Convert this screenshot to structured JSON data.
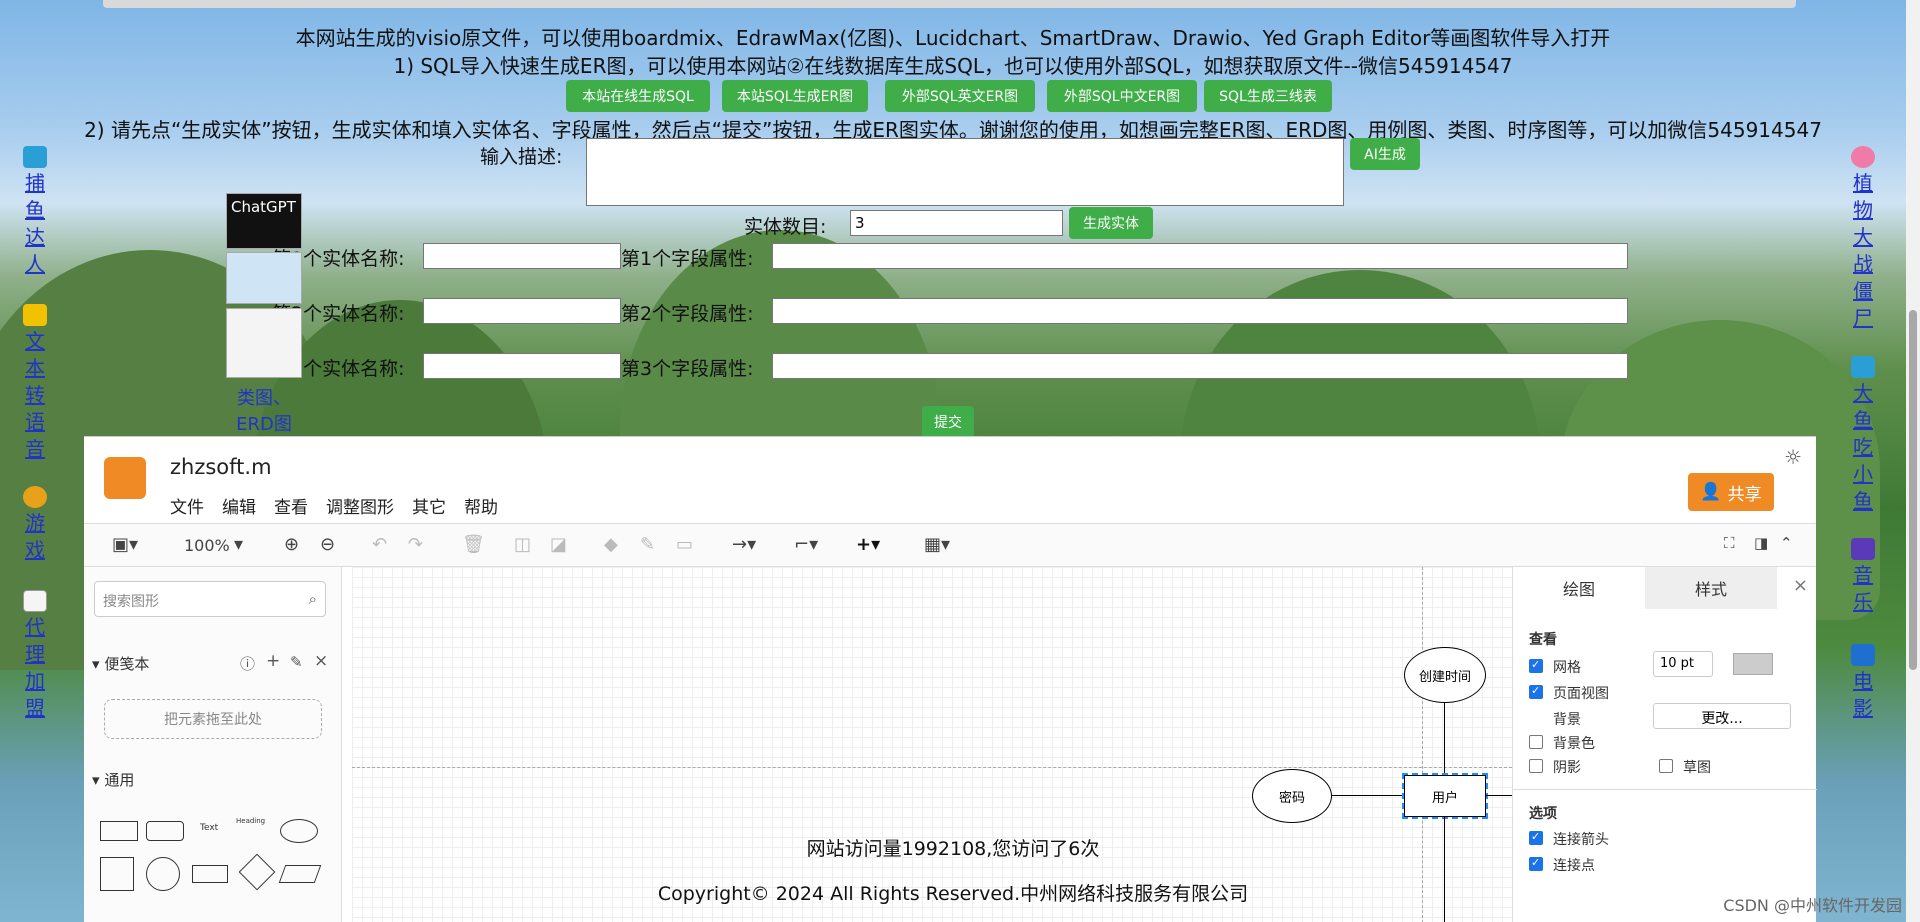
{
  "banner": {
    "line1": "本网站生成的visio原文件，可以使用boardmix、EdrawMax(亿图)、Lucidchart、SmartDraw、Drawio、Yed Graph Editor等画图软件导入打开",
    "line2": "1) SQL导入快速生成ER图，可以使用本网站②在线数据库生成SQL，也可以使用外部SQL，如想获取原文件--微信545914547",
    "line3": "2) 请先点“生成实体”按钮，生成实体和填入实体名、字段属性，然后点“提交”按钮，生成ER图实体。谢谢您的使用，如想画完整ER图、ERD图、用例图、类图、时序图等，可以加微信545914547"
  },
  "buttons": {
    "b1": "本站在线生成SQL",
    "b2": "本站SQL生成ER图",
    "b3": "外部SQL英文ER图",
    "b4": "外部SQL中文ER图",
    "b5": "SQL生成三线表",
    "ai": "AI生成",
    "gen": "生成实体",
    "submit": "提交"
  },
  "form": {
    "desc_label": "输入描述:",
    "count_label": "实体数目:",
    "count_value": "3",
    "rows": [
      {
        "name_label": "第1个实体名称:",
        "attr_label": "第1个字段属性:"
      },
      {
        "name_label": "第2个实体名称:",
        "attr_label": "第2个字段属性:"
      },
      {
        "name_label": "第3个实体名称:",
        "attr_label": "第3个字段属性:"
      }
    ]
  },
  "left_links": [
    "捕鱼达人",
    "文本转语音",
    "游戏",
    "代理加盟"
  ],
  "right_links": [
    "植物大战僵尸",
    "大鱼吃小鱼",
    "音乐",
    "电影"
  ],
  "floating_link": "类图、ERD图快速生成已正式上线，可以使用",
  "chatgpt_label": "ChatGPT",
  "editor": {
    "title": "zhzsoft.m",
    "menu": [
      "文件",
      "编辑",
      "查看",
      "调整图形",
      "其它",
      "帮助"
    ],
    "share": "共享",
    "zoom": "100%",
    "search_placeholder": "搜索图形",
    "section_scratch": "便笺本",
    "dropzone": "把元素拖至此处",
    "section_general": "通用",
    "shape_text": "Text",
    "shape_heading": "Heading",
    "tabs": [
      "绘图",
      "样式"
    ],
    "view_label": "查看",
    "grid": "网格",
    "grid_size": "10 pt",
    "page_view": "页面视图",
    "background": "背景",
    "change": "更改...",
    "bg_color": "背景色",
    "shadow": "阴影",
    "sketch": "草图",
    "options": "选项",
    "conn_arrow": "连接箭头",
    "conn_point": "连接点",
    "nodes": {
      "time": "创建时间",
      "pwd": "密码",
      "user": "用户"
    }
  },
  "footer": {
    "visits": "网站访问量1992108,您访问了6次",
    "copyright": "Copyright© 2024 All Rights Reserved.中州网络科技服务有限公司"
  },
  "watermark": "CSDN @中州软件开发园"
}
